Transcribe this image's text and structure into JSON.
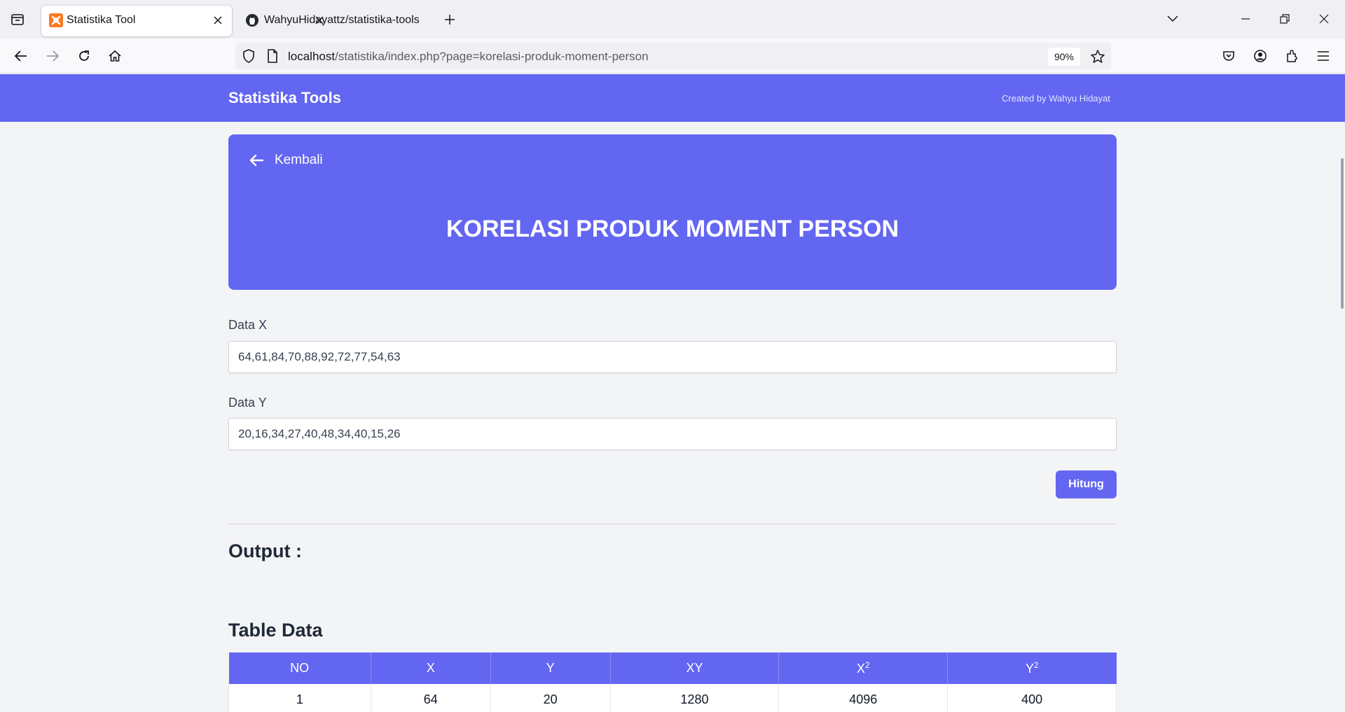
{
  "browser": {
    "tabs": [
      {
        "title": "Statistika Tool",
        "icon": "xampp-favicon"
      },
      {
        "title": "WahyuHidayattz/statistika-tools",
        "icon": "github-icon"
      }
    ],
    "url_host": "localhost",
    "url_path": "/statistika/index.php?page=korelasi-produk-moment-person",
    "zoom": "90%"
  },
  "header": {
    "brand": "Statistika Tools",
    "credit": "Created by Wahyu Hidayat",
    "color": "#6366f1"
  },
  "hero": {
    "back_label": "Kembali",
    "title": "KORELASI PRODUK MOMENT PERSON"
  },
  "form": {
    "data_x_label": "Data X",
    "data_x_value": "64,61,84,70,88,92,72,77,54,63",
    "data_y_label": "Data Y",
    "data_y_value": "20,16,34,27,40,48,34,40,15,26",
    "submit_label": "Hitung"
  },
  "output": {
    "heading": "Output :",
    "table_heading": "Table Data",
    "columns": [
      "NO",
      "X",
      "Y",
      "XY",
      "X",
      "Y"
    ],
    "column_superscripts": [
      "",
      "",
      "",
      "",
      "2",
      "2"
    ],
    "rows": [
      [
        "1",
        "64",
        "20",
        "1280",
        "4096",
        "400"
      ]
    ]
  }
}
